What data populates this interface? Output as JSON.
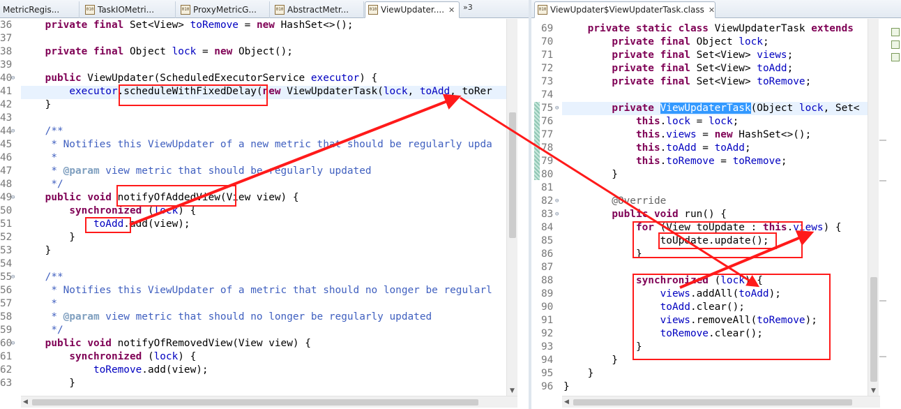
{
  "left_editor": {
    "tabs": [
      {
        "label": "MetricRegis...",
        "active": false
      },
      {
        "label": "TaskIOMetri...",
        "active": false
      },
      {
        "label": "ProxyMetricG...",
        "active": false
      },
      {
        "label": "AbstractMetr...",
        "active": false
      },
      {
        "label": "ViewUpdater....",
        "active": true
      }
    ],
    "tab_overflow": "»3",
    "tab_icon_text": "010",
    "tab_close_glyph": "✕",
    "lines": [
      {
        "n": "36",
        "code": "    private final Set<View> toRemove = new HashSet<>();"
      },
      {
        "n": "37",
        "code": ""
      },
      {
        "n": "38",
        "code": "    private final Object lock = new Object();"
      },
      {
        "n": "39",
        "code": ""
      },
      {
        "n": "40",
        "code": "    public ViewUpdater(ScheduledExecutorService executor) {"
      },
      {
        "n": "41",
        "code": "        executor.scheduleWithFixedDelay(new ViewUpdaterTask(lock, toAdd, toRer"
      },
      {
        "n": "42",
        "code": "    }"
      },
      {
        "n": "43",
        "code": ""
      },
      {
        "n": "44",
        "code": "    /**"
      },
      {
        "n": "45",
        "code": "     * Notifies this ViewUpdater of a new metric that should be regularly upda"
      },
      {
        "n": "46",
        "code": "     *"
      },
      {
        "n": "47",
        "code": "     * @param view metric that should be regularly updated"
      },
      {
        "n": "48",
        "code": "     */"
      },
      {
        "n": "49",
        "code": "    public void notifyOfAddedView(View view) {"
      },
      {
        "n": "50",
        "code": "        synchronized (lock) {"
      },
      {
        "n": "51",
        "code": "            toAdd.add(view);"
      },
      {
        "n": "52",
        "code": "        }"
      },
      {
        "n": "53",
        "code": "    }"
      },
      {
        "n": "54",
        "code": ""
      },
      {
        "n": "55",
        "code": "    /**"
      },
      {
        "n": "56",
        "code": "     * Notifies this ViewUpdater of a metric that should no longer be regularl"
      },
      {
        "n": "57",
        "code": "     *"
      },
      {
        "n": "58",
        "code": "     * @param view metric that should no longer be regularly updated"
      },
      {
        "n": "59",
        "code": "     */"
      },
      {
        "n": "60",
        "code": "    public void notifyOfRemovedView(View view) {"
      },
      {
        "n": "61",
        "code": "        synchronized (lock) {"
      },
      {
        "n": "62",
        "code": "            toRemove.add(view);"
      },
      {
        "n": "63",
        "code": "        }"
      }
    ]
  },
  "right_editor": {
    "tab": {
      "label": "ViewUpdater$ViewUpdaterTask.class",
      "active": true
    },
    "tab_icon_text": "010",
    "tab_close_glyph": "✕",
    "lines": [
      {
        "n": "69",
        "code": "    private static class ViewUpdaterTask extends"
      },
      {
        "n": "70",
        "code": "        private final Object lock;"
      },
      {
        "n": "71",
        "code": "        private final Set<View> views;"
      },
      {
        "n": "72",
        "code": "        private final Set<View> toAdd;"
      },
      {
        "n": "73",
        "code": "        private final Set<View> toRemove;"
      },
      {
        "n": "74",
        "code": ""
      },
      {
        "n": "75",
        "code": "        private ViewUpdaterTask(Object lock, Set<"
      },
      {
        "n": "76",
        "code": "            this.lock = lock;"
      },
      {
        "n": "77",
        "code": "            this.views = new HashSet<>();"
      },
      {
        "n": "78",
        "code": "            this.toAdd = toAdd;"
      },
      {
        "n": "79",
        "code": "            this.toRemove = toRemove;"
      },
      {
        "n": "80",
        "code": "        }"
      },
      {
        "n": "81",
        "code": ""
      },
      {
        "n": "82",
        "code": "        @Override"
      },
      {
        "n": "83",
        "code": "        public void run() {"
      },
      {
        "n": "84",
        "code": "            for (View toUpdate : this.views) {"
      },
      {
        "n": "85",
        "code": "                toUpdate.update();"
      },
      {
        "n": "86",
        "code": "            }"
      },
      {
        "n": "87",
        "code": ""
      },
      {
        "n": "88",
        "code": "            synchronized (lock) {"
      },
      {
        "n": "89",
        "code": "                views.addAll(toAdd);"
      },
      {
        "n": "90",
        "code": "                toAdd.clear();"
      },
      {
        "n": "91",
        "code": "                views.removeAll(toRemove);"
      },
      {
        "n": "92",
        "code": "                toRemove.clear();"
      },
      {
        "n": "93",
        "code": "            }"
      },
      {
        "n": "94",
        "code": "        }"
      },
      {
        "n": "95",
        "code": "    }"
      },
      {
        "n": "96",
        "code": "}"
      }
    ]
  },
  "colors": {
    "keyword": "#7f0055",
    "field": "#0000c0",
    "comment": "#3f5fbf",
    "annotation_box": "#ff1a1a",
    "selection": "#3399ff",
    "current_line": "#e8f2fe"
  }
}
